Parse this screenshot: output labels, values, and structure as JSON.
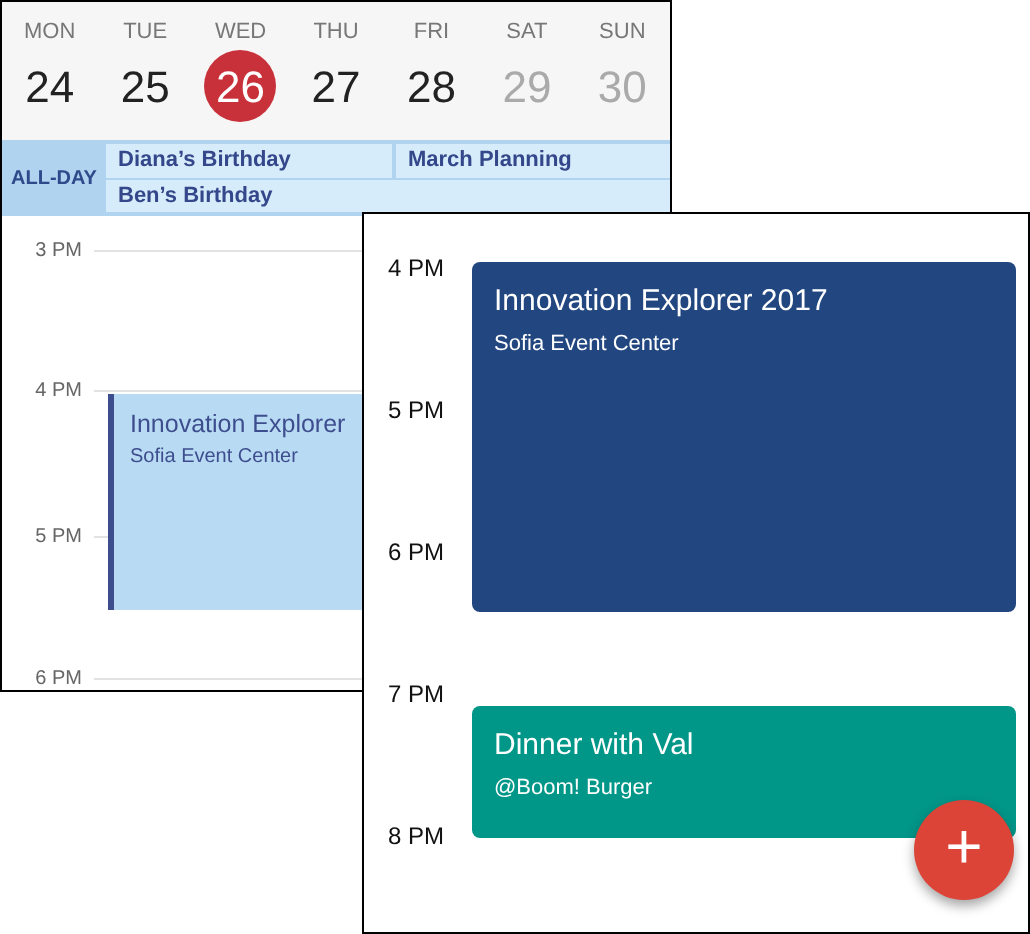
{
  "week_view": {
    "days": [
      {
        "weekday": "MON",
        "date": "24",
        "selected": false,
        "dimmed": false
      },
      {
        "weekday": "TUE",
        "date": "25",
        "selected": false,
        "dimmed": false
      },
      {
        "weekday": "WED",
        "date": "26",
        "selected": true,
        "dimmed": false
      },
      {
        "weekday": "THU",
        "date": "27",
        "selected": false,
        "dimmed": false
      },
      {
        "weekday": "FRI",
        "date": "28",
        "selected": false,
        "dimmed": false
      },
      {
        "weekday": "SAT",
        "date": "29",
        "selected": false,
        "dimmed": true
      },
      {
        "weekday": "SUN",
        "date": "30",
        "selected": false,
        "dimmed": true
      }
    ],
    "all_day": {
      "label": "ALL-DAY",
      "events": [
        {
          "title": "Diana’s Birthday"
        },
        {
          "title": "March Planning"
        },
        {
          "title": "Ben’s Birthday"
        }
      ]
    },
    "hours": [
      "3 PM",
      "4 PM",
      "5 PM",
      "6 PM"
    ],
    "events": [
      {
        "title": "Innovation Explorer",
        "location": "Sofia Event Center"
      }
    ]
  },
  "day_view": {
    "hours": [
      "4 PM",
      "5 PM",
      "6 PM",
      "7 PM",
      "8 PM"
    ],
    "events": [
      {
        "title": "Innovation Explorer 2017",
        "location": "Sofia Event Center",
        "color": "#22467f"
      },
      {
        "title": "Dinner with Val",
        "location": "@Boom! Burger",
        "color": "#009688"
      }
    ]
  },
  "add_button": {
    "label": "+"
  }
}
